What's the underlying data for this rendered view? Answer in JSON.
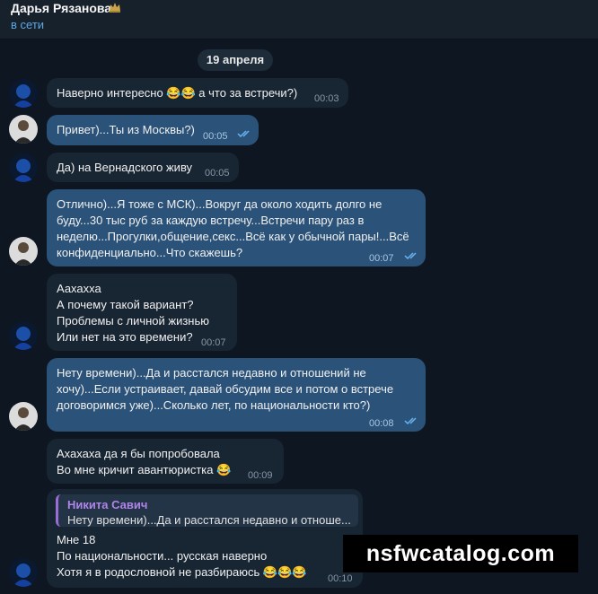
{
  "header": {
    "chat_name": "Дарья Рязанова",
    "status": "в сети"
  },
  "date_chip": "19 апреля",
  "colors": {
    "background": "#0e1621",
    "header": "#17212b",
    "incoming_bubble": "#182533",
    "outgoing_bubble": "#2b5278",
    "status_blue": "#5fa7e6",
    "reply_name": "#b184ea",
    "read_ticks": "#6ab3f3"
  },
  "messages": [
    {
      "direction": "incoming",
      "text": "Наверно интересно 😂😂 а что за встречи?)",
      "time": "00:03"
    },
    {
      "direction": "outgoing",
      "text": "Привет)...Ты из Москвы?)",
      "time": "00:05",
      "read": true
    },
    {
      "direction": "incoming",
      "text": "Да) на Вернадского живу",
      "time": "00:05"
    },
    {
      "direction": "outgoing",
      "lines": [
        "Отлично)...Я тоже с МСК)...Вокруг да около ходить долго не",
        "буду...30 тыс руб за каждую встречу...Встречи пару раз в",
        "неделю...Прогулки,общение,секс...Всё как у обычной пары!...Всё",
        "конфиденциально...Что скажешь?"
      ],
      "time": "00:07",
      "read": true
    },
    {
      "direction": "incoming",
      "lines": [
        "Аахахха",
        "А почему такой вариант?",
        "Проблемы с личной жизнью",
        "Или нет на это времени?"
      ],
      "time": "00:07"
    },
    {
      "direction": "outgoing",
      "lines": [
        "Нету времени)...Да и расстался недавно и отношений не",
        "хочу)...Если устраивает, давай обсудим все и потом о встрече",
        "договоримся уже)...Сколько лет, по национальности кто?)"
      ],
      "time": "00:08",
      "read": true
    },
    {
      "direction": "incoming",
      "lines": [
        "Ахахаха да я бы попробовала",
        "Во мне кричит авантюристка 😂"
      ],
      "time": "00:09"
    },
    {
      "direction": "incoming",
      "reply": {
        "name": "Никита Савич",
        "text": "Нету времени)...Да и расстался недавно и отноше..."
      },
      "lines": [
        "Мне 18",
        "По национальности... русская наверно",
        "Хотя я в родословной не разбираюсь 😂😂😂"
      ],
      "time": "00:10"
    }
  ],
  "watermark": "nsfwcatalog.com"
}
